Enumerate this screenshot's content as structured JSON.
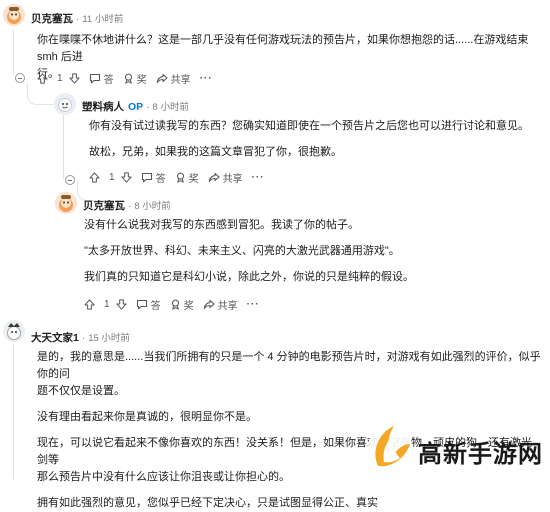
{
  "comments": [
    {
      "author": "贝克塞瓦",
      "time": "11 小时前",
      "paragraphs": [
        "你在喋喋不休地讲什么？这是一部几乎没有任何游戏玩法的预告片，如果你想抱怨的话......在游戏结束 smh 后进",
        "行。"
      ],
      "votes": "1",
      "reply_label": "答",
      "award_label": "奖",
      "share_label": "共享"
    },
    {
      "author": "塑料病人",
      "op_badge": "OP",
      "time": "8 小时前",
      "paragraphs": [
        "你有没有试过读我写的东西？您确实知道即使在一个预告片之后您也可以进行讨论和意见。",
        "故松，兄弟，如果我的这篇文章冒犯了你，很抱歉。"
      ],
      "votes": "1",
      "reply_label": "答",
      "award_label": "奖",
      "share_label": "共享"
    },
    {
      "author": "贝克塞瓦",
      "time": "8 小时前",
      "paragraphs": [
        "没有什么说我对我写的东西感到冒犯。我读了你的帖子。",
        "\"太多开放世界、科幻、未来主义、闪亮的大激光武器通用游戏\"。",
        "我们真的只知道它是科幻小说，除此之外，你说的只是纯粹的假设。"
      ],
      "votes": "1",
      "reply_label": "答",
      "award_label": "奖",
      "share_label": "共享"
    },
    {
      "author": "大天文家1",
      "time": "15 小时前",
      "paragraphs": [
        "是的，我的意思是......当我们所拥有的只是一个 4 分钟的电影预告片时，对游戏有如此强烈的评价，似乎你的问",
        "题不仅仅是设置。",
        "没有理由看起来你是真诚的，很明显你不是。",
        "现在，可以说它看起来不像你喜欢的东西！没关系！但是，如果你喜欢太空鸟物、顽皮的狗，还有激光剑等",
        "那么预告片中没有什么应该让你沮丧或让你担心的。",
        "拥有如此强烈的意见，您似乎已经下定决心，只是试图显得公正、真实"
      ]
    }
  ],
  "watermark": {
    "text": "高新手游网"
  },
  "colors": {
    "op_blue": "#0079d3",
    "meta_gray": "#7c7c7c",
    "thread_line": "#dfe1e3"
  }
}
